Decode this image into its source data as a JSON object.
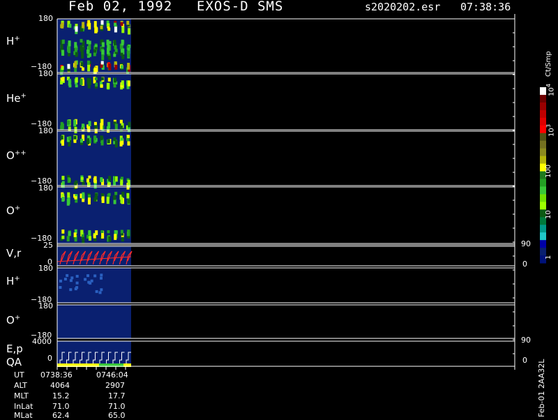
{
  "header": {
    "date": "Feb 02, 1992",
    "instrument": "EXOS-D SMS",
    "file": "s2020202.esr",
    "time": "07:38:36"
  },
  "panels": [
    {
      "label": "H",
      "sup": "+",
      "ymax": "180",
      "ymin": "−180"
    },
    {
      "label": "He",
      "sup": "+",
      "ymax": "180",
      "ymin": "−180"
    },
    {
      "label": "O",
      "sup": "++",
      "ymax": "180",
      "ymin": "−180"
    },
    {
      "label": "O",
      "sup": "+",
      "ymax": "180",
      "ymin": "−180"
    },
    {
      "label": "V,r",
      "sup": "",
      "ymax": "25",
      "ymin": "0",
      "right_top": "90",
      "right_bottom": "0"
    },
    {
      "label": "H",
      "sup": "+",
      "ymax": "180",
      "ymin": "−180"
    },
    {
      "label": "O",
      "sup": "+",
      "ymax": "180",
      "ymin": "−180"
    },
    {
      "label": "E,p",
      "label2": "QA",
      "sup": "",
      "ymax": "4000",
      "ymin": "0",
      "right_top": "90",
      "right_bottom": "0"
    }
  ],
  "colorbar": {
    "unit": "Ct/Smp",
    "labels": [
      {
        "base": "10",
        "exp": "4"
      },
      {
        "base": "10",
        "exp": "3"
      },
      {
        "base": "100",
        "exp": ""
      },
      {
        "base": "10",
        "exp": ""
      },
      {
        "base": "1",
        "exp": ""
      }
    ],
    "colors": [
      "#ffffff",
      "#6e0000",
      "#9a0000",
      "#c00000",
      "#e00000",
      "#ff0000",
      "#505014",
      "#747020",
      "#8c8a1e",
      "#b4b40a",
      "#ffff00",
      "#1e7a1e",
      "#24a024",
      "#38c838",
      "#70e000",
      "#9cff00",
      "#0d5a14",
      "#007a3c",
      "#009a8a",
      "#20c8c8",
      "#0000a8",
      "#0a2070",
      "#00127a"
    ]
  },
  "footer": {
    "rows": [
      {
        "name": "UT",
        "v1": "0738:36",
        "v2": "0746:04"
      },
      {
        "name": "ALT",
        "v1": "4064",
        "v2": "2907"
      },
      {
        "name": "MLT",
        "v1": "15.2",
        "v2": "17.7"
      },
      {
        "name": "InLat",
        "v1": "71.0",
        "v2": "71.0"
      },
      {
        "name": "MLat",
        "v1": "62.4",
        "v2": "65.0"
      }
    ],
    "id": "Feb-01 2AA32L"
  },
  "colors": {
    "background": "#000000",
    "axis": "#ffffff",
    "panel_fill": "#0a2070",
    "velocity_trace": "#ff2a2a"
  },
  "chart_data": {
    "type": "heatmap",
    "title": "Feb 02, 1992   EXOS-D SMS",
    "time_range": [
      "07:38:36",
      "07:46:04"
    ],
    "colorbar_scale": "log",
    "colorbar_range": [
      1,
      10000
    ],
    "series": [
      {
        "name": "H+",
        "ylim": [
          -180,
          180
        ]
      },
      {
        "name": "He+",
        "ylim": [
          -180,
          180
        ]
      },
      {
        "name": "O++",
        "ylim": [
          -180,
          180
        ]
      },
      {
        "name": "O+",
        "ylim": [
          -180,
          180
        ]
      },
      {
        "name": "V,r",
        "ylim": [
          0,
          25
        ],
        "ylim_right": [
          0,
          90
        ]
      },
      {
        "name": "H+",
        "ylim": [
          -180,
          180
        ]
      },
      {
        "name": "O+",
        "ylim": [
          -180,
          180
        ]
      },
      {
        "name": "E,p / QA",
        "ylim": [
          0,
          4000
        ],
        "ylim_right": [
          0,
          90
        ]
      }
    ],
    "grid": false
  }
}
